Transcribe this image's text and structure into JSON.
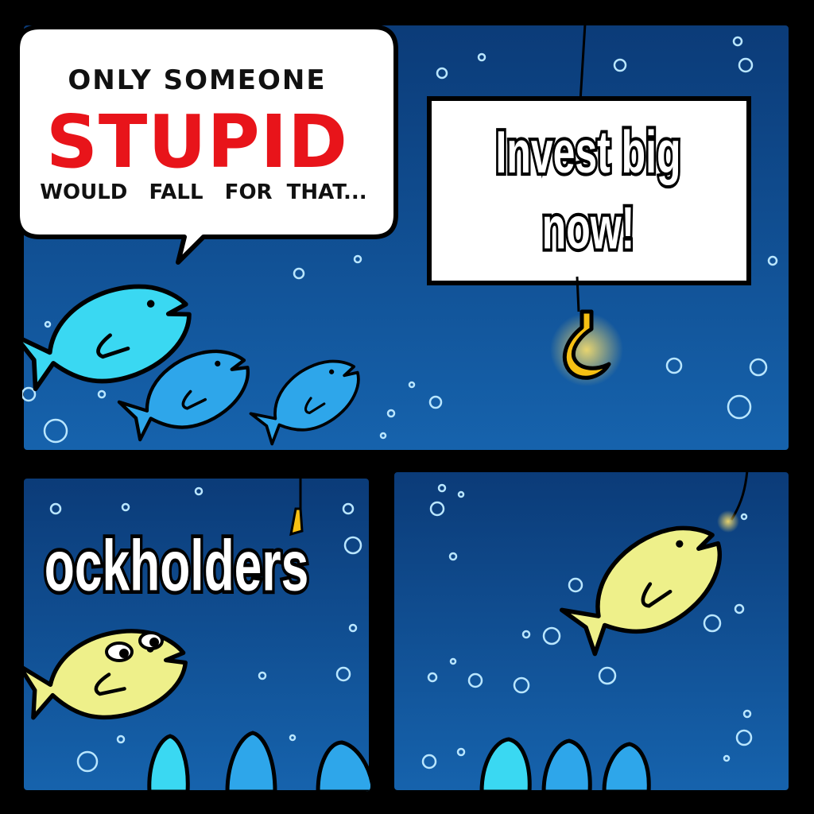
{
  "speech_bubble": {
    "line1": "ONLY SOMEONE",
    "line2": "STUPID",
    "line3": "WOULD   FALL   FOR  THAT..."
  },
  "bait_sign": {
    "line1": "Invest big",
    "line2": "now!"
  },
  "caption": {
    "text": "ockholders"
  },
  "colors": {
    "water_top": "#0b3d7a",
    "water_bottom": "#12569e",
    "fish_cyan": "#3ad7f0",
    "fish_blue": "#2aa2e6",
    "fish_yellow": "#eef08a",
    "hook_gold": "#f2b705",
    "stupid_red": "#e8141a"
  }
}
